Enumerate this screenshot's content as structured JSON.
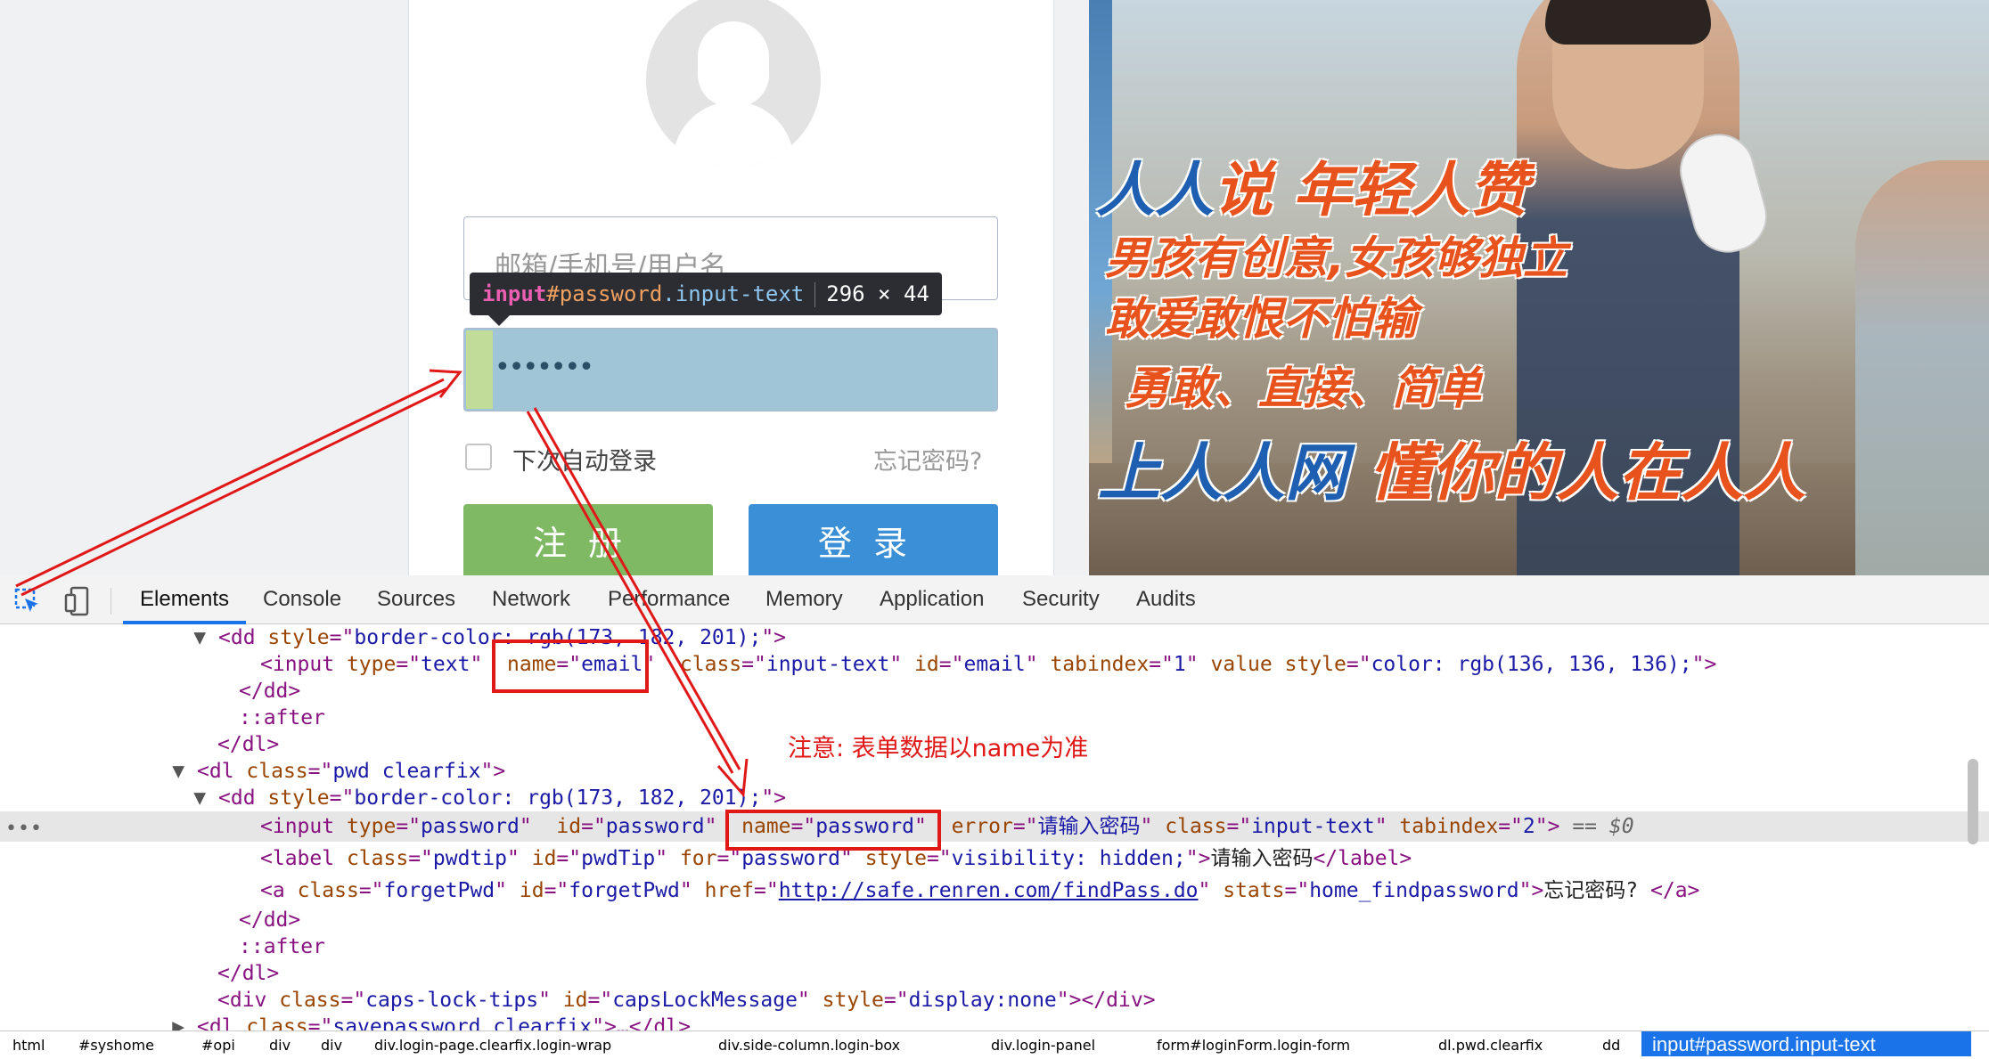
{
  "login": {
    "email_placeholder": "邮箱/手机号/用户名",
    "password_value": "•••••••",
    "remember_label": "下次自动登录",
    "forgot_label": "忘记密码?",
    "register_label": "注册",
    "login_label": "登录"
  },
  "tooltip": {
    "tag": "input",
    "id": "#password",
    "cls": ".input-text",
    "size": "296 × 44"
  },
  "banner": {
    "slogan1a": "人人",
    "slogan1b": "说 年轻人赞",
    "slogan2": "男孩有创意,女孩够独立",
    "slogan3": "敢爱敢恨不怕输",
    "slogan4": "勇敢、直接、简单",
    "slogan5a": "上人人网",
    "slogan5b": " 懂你的人在人人"
  },
  "devtools": {
    "tabs": [
      "Elements",
      "Console",
      "Sources",
      "Network",
      "Performance",
      "Memory",
      "Application",
      "Security",
      "Audits"
    ],
    "active_tab": "Elements",
    "breadcrumbs": [
      "html",
      "#syshome",
      "#opi",
      "div",
      "div",
      "div.login-page.clearfix.login-wrap",
      "div.side-column.login-box",
      "div.login-panel",
      "form#loginForm.login-form",
      "dl.pwd.clearfix",
      "dd"
    ],
    "breadcrumb_active": "input#password.input-text",
    "code": {
      "l1_style": "border-color: rgb(173, 182, 201);",
      "l2_type": "text",
      "l2_name": "email",
      "l2_class": "input-text",
      "l2_id": "email",
      "l2_tabindex": "1",
      "l2_style": "color: rgb(136, 136, 136);",
      "l5_after": "::after",
      "l7_class": "pwd clearfix",
      "l8_style": "border-color: rgb(173, 182, 201);",
      "l9_type": "password",
      "l9_id": "password",
      "l9_name": "password",
      "l9_error": "请输入密码",
      "l9_class": "input-text",
      "l9_tabindex": "2",
      "l9_eq": "== $0",
      "l10_class": "pwdtip",
      "l10_id": "pwdTip",
      "l10_for": "password",
      "l10_style": "visibility: hidden;",
      "l10_text": "请输入密码",
      "l11_class": "forgetPwd",
      "l11_id": "forgetPwd",
      "l11_href": "http://safe.renren.com/findPass.do",
      "l11_stats": "home_findpassword",
      "l11_text": "忘记密码? ",
      "l15_class": "caps-lock-tips",
      "l15_id": "capsLockMessage",
      "l15_style": "display:none",
      "l16_class": "savepassword clearfix"
    }
  },
  "annotation": {
    "note": "注意: 表单数据以name为准"
  },
  "colors": {
    "annotation_red": "#e01818",
    "register_green": "#7fb963",
    "login_blue": "#3a8fd6",
    "devtools_accent": "#1a73e8"
  }
}
